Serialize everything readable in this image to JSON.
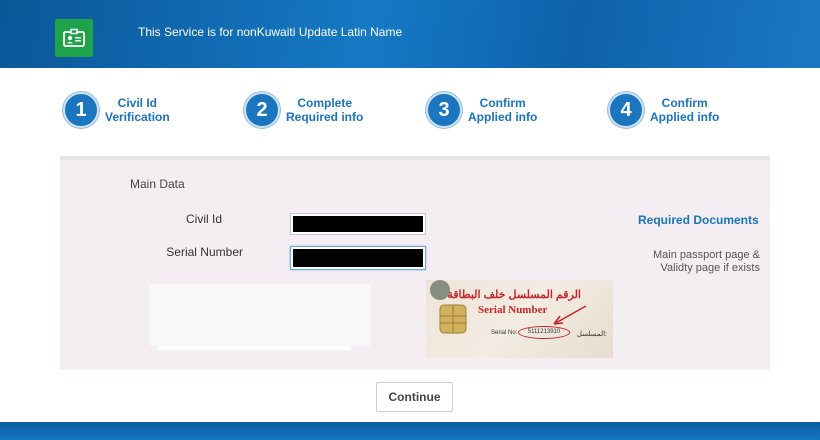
{
  "header": {
    "title": "This Service is for nonKuwaiti Update Latin Name",
    "logo_icon": "id-card-icon",
    "logo_color": "#1ea34a"
  },
  "steps": [
    {
      "number": "1",
      "line1": "Civil Id",
      "line2": "Verification"
    },
    {
      "number": "2",
      "line1": "Complete",
      "line2": "Required info"
    },
    {
      "number": "3",
      "line1": "Confirm",
      "line2": "Applied info"
    },
    {
      "number": "4",
      "line1": "Confirm",
      "line2": "Applied info"
    }
  ],
  "form": {
    "section_title": "Main Data",
    "civil_id_label": "Civil Id",
    "serial_number_label": "Serial Number"
  },
  "required_docs": {
    "link": "Required Documents",
    "note": "Main passport page & Validty page if exists"
  },
  "card_image": {
    "arabic_caption": "الرقم المسلسل خلف البطاقة",
    "caption": "Serial Number",
    "serial_label": "Serial No:",
    "serial_value": "5111213910",
    "arabic_label": "المسلسل:"
  },
  "continue_label": "Continue",
  "colors": {
    "accent": "#1a73bd",
    "brand_blue": "#1579c4"
  }
}
